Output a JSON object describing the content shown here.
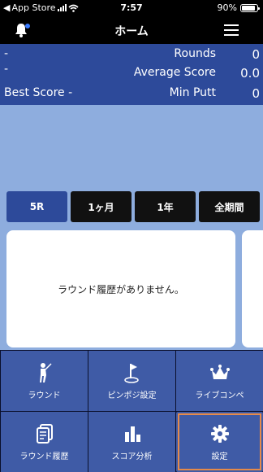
{
  "status_bar": {
    "carrier": "App Store",
    "time": "7:57",
    "battery": "90%",
    "battery_level": 0.9
  },
  "nav": {
    "title": "ホーム"
  },
  "stats": {
    "left_1": "-",
    "left_2": "-",
    "best_score_label": "Best Score -",
    "rounds_label": "Rounds",
    "rounds_value": "0",
    "avg_label": "Average Score",
    "avg_value": "0.0",
    "min_putt_label": "Min Putt",
    "min_putt_value": "0"
  },
  "period_tabs": [
    "5R",
    "1ヶ月",
    "1年",
    "全期間"
  ],
  "empty_message": "ラウンド履歴がありません。",
  "menu": [
    {
      "label": "ラウンド",
      "icon": "golfer-icon"
    },
    {
      "label": "ピンポジ設定",
      "icon": "pin-flag-icon"
    },
    {
      "label": "ライブコンペ",
      "icon": "crown-icon"
    },
    {
      "label": "ラウンド履歴",
      "icon": "scorecards-icon"
    },
    {
      "label": "スコア分析",
      "icon": "bar-chart-icon"
    },
    {
      "label": "設定",
      "icon": "gear-icon"
    }
  ],
  "colors": {
    "primary": "#2d4a9a",
    "tile": "#3f5ba6",
    "graph_bg": "#8eadde",
    "highlight": "#e58a4a"
  }
}
